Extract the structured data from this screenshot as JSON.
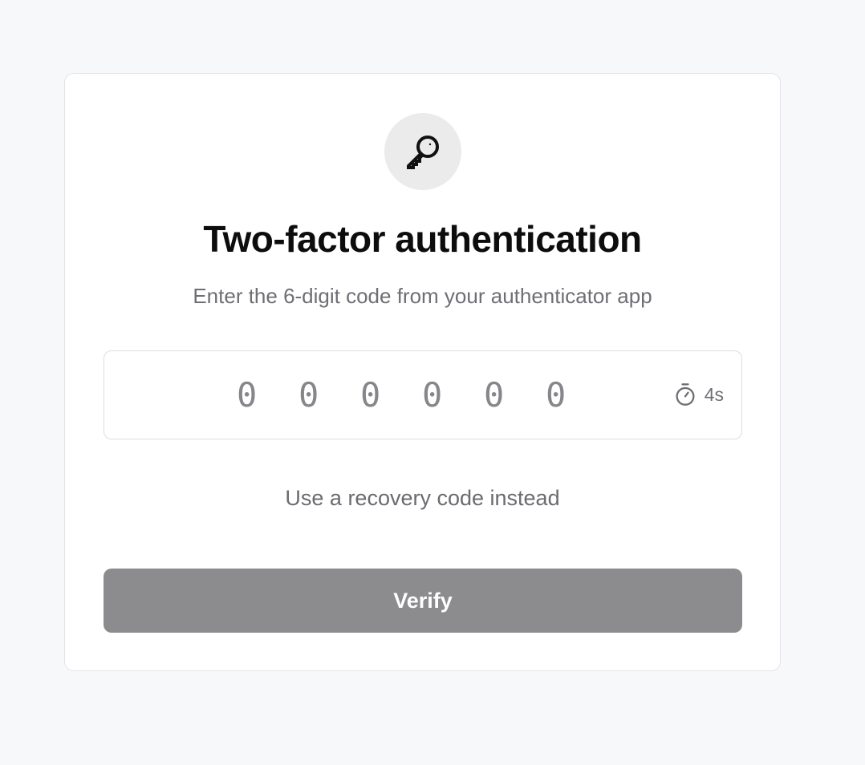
{
  "icon": "key-icon",
  "title": "Two-factor authentication",
  "subtitle": "Enter the 6-digit code from your authenticator app",
  "code": {
    "digits": [
      "0",
      "0",
      "0",
      "0",
      "0",
      "0"
    ],
    "timer_icon": "stopwatch-icon",
    "timer_value": "4s"
  },
  "recovery_link": "Use a recovery code instead",
  "verify_button": "Verify",
  "colors": {
    "background": "#f7f8fa",
    "card": "#ffffff",
    "button": "#8c8c8f",
    "muted_text": "#6e6e74"
  }
}
